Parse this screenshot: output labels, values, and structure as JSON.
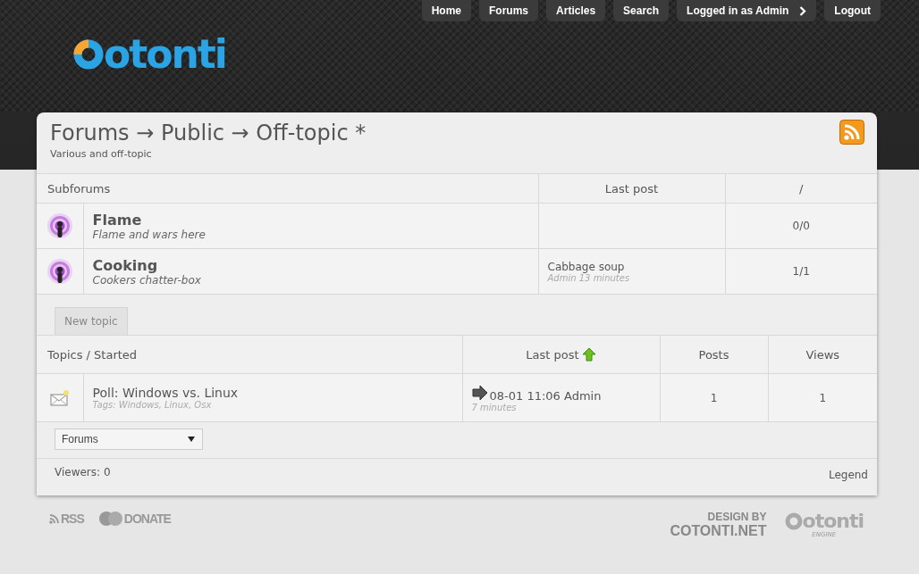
{
  "nav": [
    {
      "label": "Home",
      "kind": "link"
    },
    {
      "label": "Forums",
      "kind": "link"
    },
    {
      "label": "Articles",
      "kind": "link"
    },
    {
      "label": "Search",
      "kind": "link"
    },
    {
      "label": "Logged in as Admin",
      "kind": "menu"
    },
    {
      "label": "Logout",
      "kind": "link"
    }
  ],
  "logo": {
    "text": "otonti"
  },
  "header": {
    "title": "Forums → Public → Off-topic *",
    "subtitle": "Various and off-topic"
  },
  "subforums": {
    "columns": [
      "Subforums",
      "Last post",
      "/"
    ],
    "rows": [
      {
        "name": "Flame",
        "description": "Flame and wars here",
        "last_post": null,
        "count": "0/0"
      },
      {
        "name": "Cooking",
        "description": "Cookers chatter-box",
        "last_post": {
          "title": "Cabbage soup",
          "meta": "Admin 13 minutes"
        },
        "count": "1/1"
      }
    ]
  },
  "new_topic": "New topic",
  "topics": {
    "columns": [
      "Topics / Started",
      "Last post",
      "Posts",
      "Views"
    ],
    "rows": [
      {
        "title": "Poll: Windows vs. Linux",
        "tags": "Tags: Windows, Linux, Osx",
        "last_post": "08-01 11:06 Admin",
        "ago": "7 minutes",
        "posts": "1",
        "views": "1"
      }
    ]
  },
  "jump": {
    "value": "Forums"
  },
  "viewers": "Viewers: 0",
  "legend": "Legend",
  "footer": {
    "rss": "RSS",
    "donate": "DONATE",
    "design_by": "DESIGN BY",
    "site": "COTONTI.NET",
    "engine_logo": "otonti",
    "engine": "ENGINE"
  }
}
